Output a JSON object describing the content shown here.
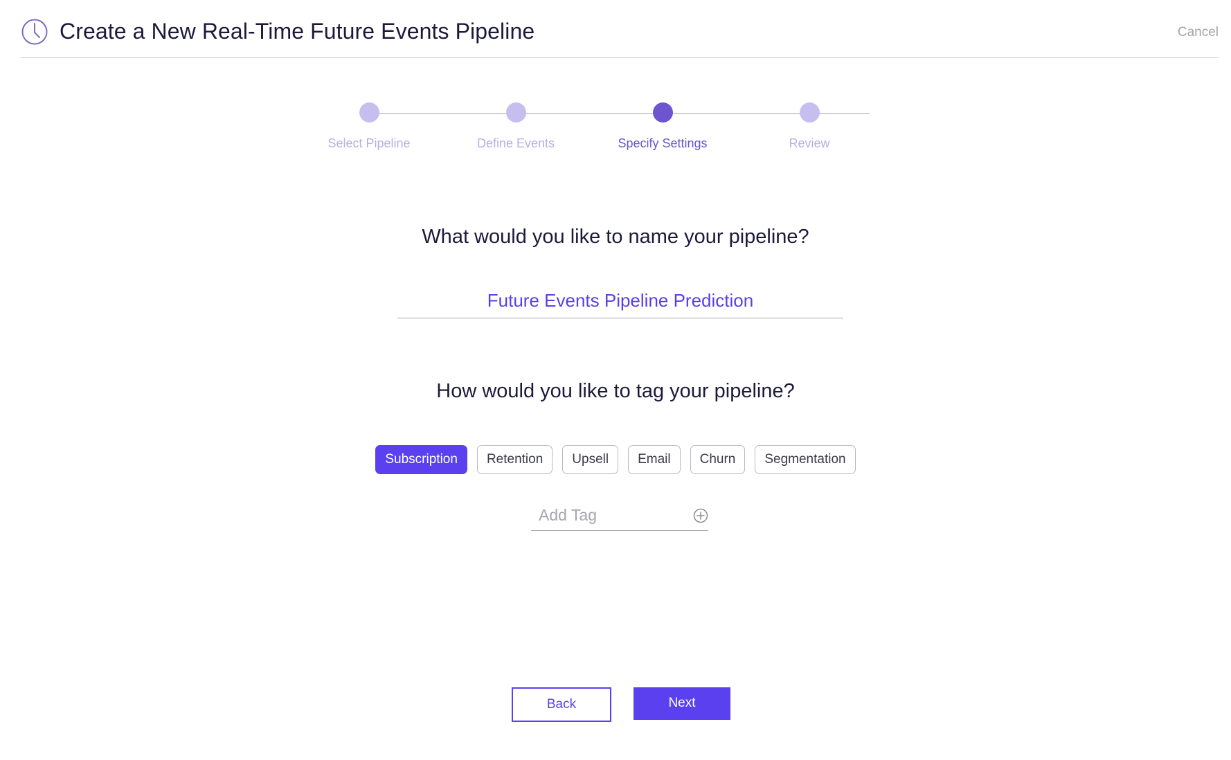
{
  "header": {
    "title": "Create a New Real-Time Future Events Pipeline",
    "cancel_label": "Cancel",
    "icon": "clock-icon"
  },
  "stepper": {
    "steps": [
      {
        "label": "Select Pipeline",
        "state": "done"
      },
      {
        "label": "Define Events",
        "state": "done"
      },
      {
        "label": "Specify Settings",
        "state": "active"
      },
      {
        "label": "Review",
        "state": "pending"
      }
    ]
  },
  "name_section": {
    "question": "What would you like to name your pipeline?",
    "value": "Future Events Pipeline Prediction"
  },
  "tag_section": {
    "question": "How would you like to tag your pipeline?",
    "tags": [
      {
        "label": "Subscription",
        "selected": true
      },
      {
        "label": "Retention",
        "selected": false
      },
      {
        "label": "Upsell",
        "selected": false
      },
      {
        "label": "Email",
        "selected": false
      },
      {
        "label": "Churn",
        "selected": false
      },
      {
        "label": "Segmentation",
        "selected": false
      }
    ],
    "add_tag_placeholder": "Add Tag",
    "add_icon": "plus-circle-icon"
  },
  "footer": {
    "back_label": "Back",
    "next_label": "Next"
  },
  "colors": {
    "accent": "#5a40ef",
    "step_active": "#6d55cf",
    "step_inactive": "#c7bef0"
  }
}
